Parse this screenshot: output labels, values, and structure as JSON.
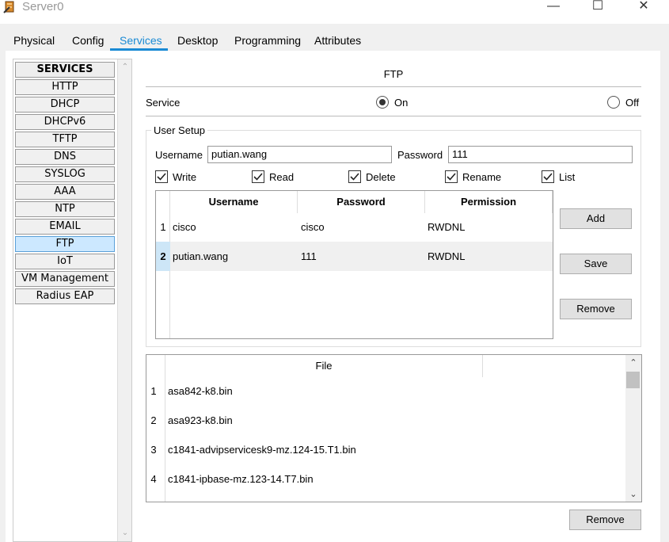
{
  "window": {
    "title": "Server0"
  },
  "tabs": [
    "Physical",
    "Config",
    "Services",
    "Desktop",
    "Programming",
    "Attributes"
  ],
  "active_tab": "Services",
  "services": {
    "header": "SERVICES",
    "items": [
      "HTTP",
      "DHCP",
      "DHCPv6",
      "TFTP",
      "DNS",
      "SYSLOG",
      "AAA",
      "NTP",
      "EMAIL",
      "FTP",
      "IoT",
      "VM Management",
      "Radius EAP"
    ],
    "active": "FTP"
  },
  "ftp": {
    "title": "FTP",
    "service_label": "Service",
    "on_label": "On",
    "off_label": "Off",
    "service_on": true,
    "user_setup": {
      "legend": "User Setup",
      "username_label": "Username",
      "username_value": "putian.wang",
      "password_label": "Password",
      "password_value": "111",
      "permissions": [
        {
          "label": "Write",
          "checked": true
        },
        {
          "label": "Read",
          "checked": true
        },
        {
          "label": "Delete",
          "checked": true
        },
        {
          "label": "Rename",
          "checked": true
        },
        {
          "label": "List",
          "checked": true
        }
      ],
      "columns": [
        "Username",
        "Password",
        "Permission"
      ],
      "users": [
        {
          "n": "1",
          "username": "cisco",
          "password": "cisco",
          "permission": "RWDNL"
        },
        {
          "n": "2",
          "username": "putian.wang",
          "password": "111",
          "permission": "RWDNL"
        }
      ],
      "add_label": "Add",
      "save_label": "Save",
      "remove_label": "Remove"
    },
    "files": {
      "column": "File",
      "items": [
        {
          "n": "1",
          "name": "asa842-k8.bin"
        },
        {
          "n": "2",
          "name": "asa923-k8.bin"
        },
        {
          "n": "3",
          "name": "c1841-advipservicesk9-mz.124-15.T1.bin"
        },
        {
          "n": "4",
          "name": "c1841-ipbase-mz.123-14.T7.bin"
        }
      ],
      "remove_label": "Remove"
    }
  }
}
